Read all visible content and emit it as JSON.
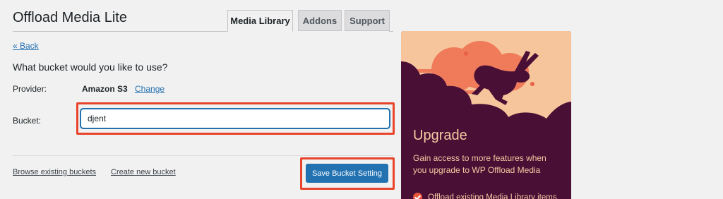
{
  "header": {
    "title": "Offload Media Lite",
    "tabs": [
      {
        "label": "Media Library",
        "active": true
      },
      {
        "label": "Addons",
        "active": false
      },
      {
        "label": "Support",
        "active": false
      }
    ]
  },
  "form": {
    "back_label": "« Back",
    "question": "What bucket would you like to use?",
    "provider_label": "Provider:",
    "provider_value": "Amazon S3",
    "change_label": "Change",
    "bucket_label": "Bucket:",
    "bucket_value": "djent",
    "browse_label": "Browse existing buckets",
    "create_label": "Create new bucket",
    "save_label": "Save Bucket Setting"
  },
  "promo": {
    "heading": "Upgrade",
    "text": "Gain access to more features when you upgrade to WP Offload Media",
    "items": [
      "Offload existing Media Library items"
    ]
  },
  "colors": {
    "accent": "#2271b1",
    "highlight": "#e8442b",
    "promo_background": "#4a0f35",
    "promo_art": "#f7c59b"
  }
}
